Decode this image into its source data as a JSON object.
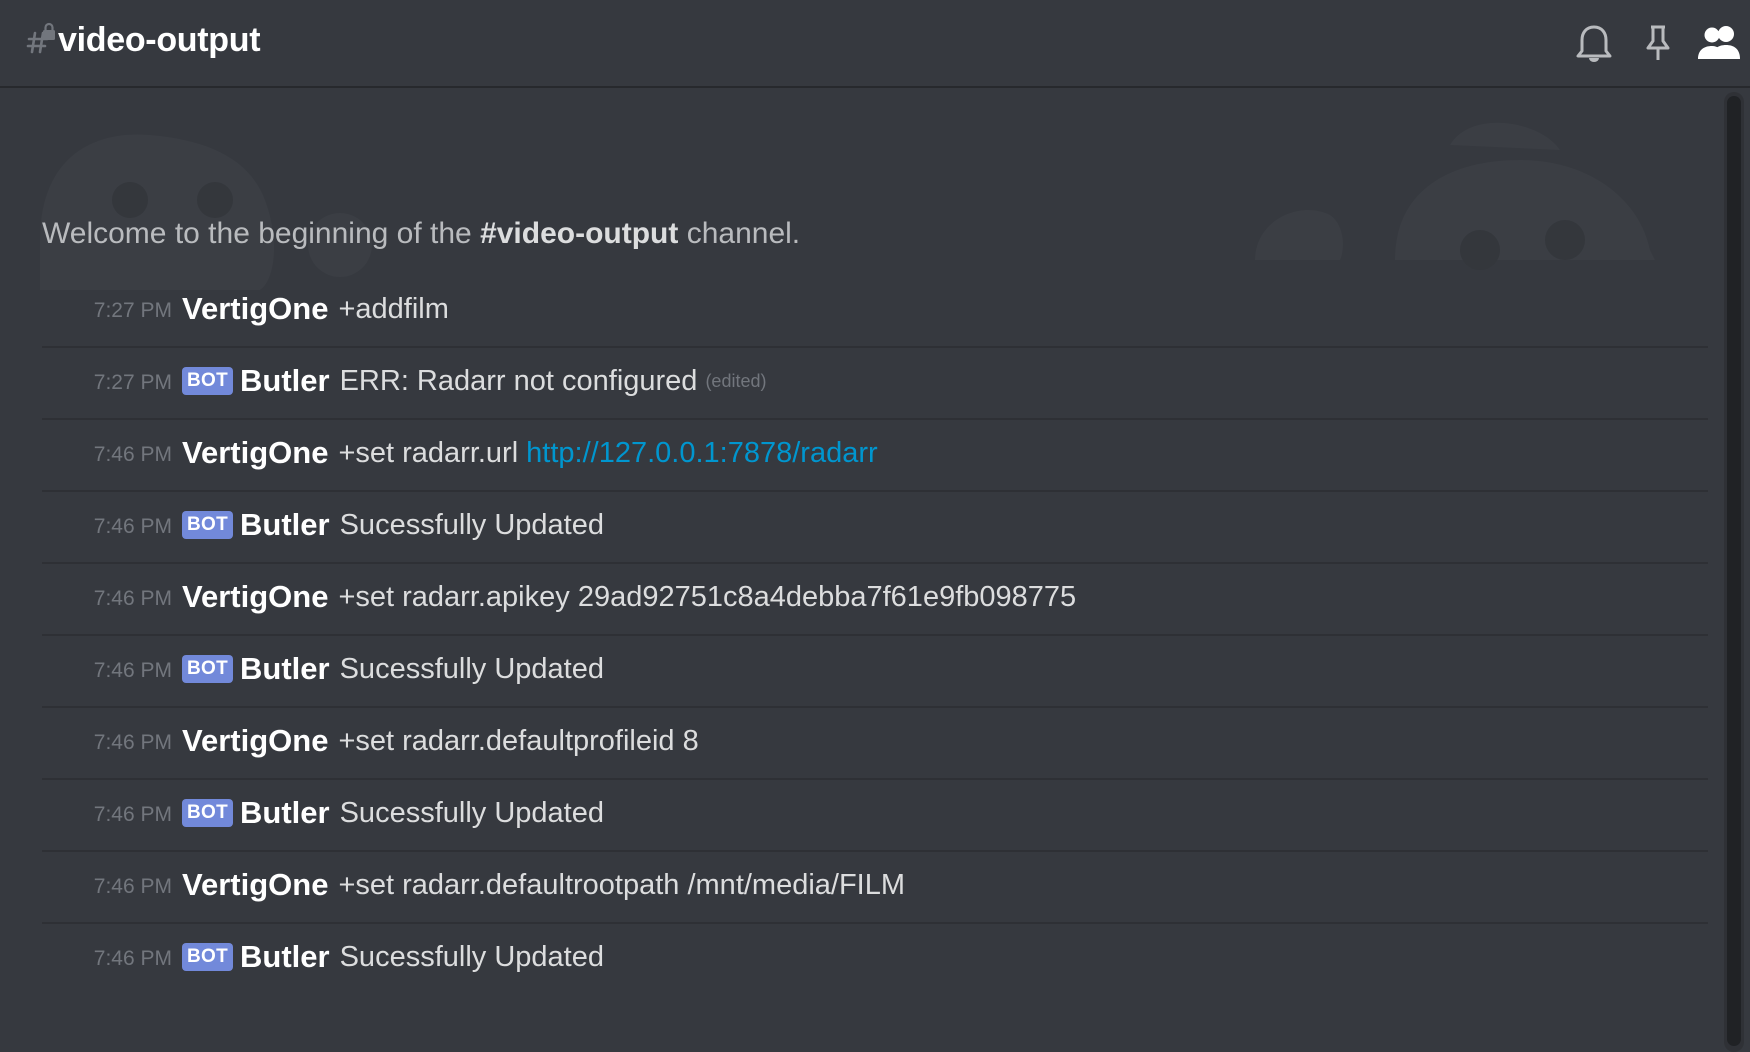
{
  "header": {
    "channel_name": "video-output",
    "icons": [
      "locked-channel-hash-icon",
      "bell-icon",
      "pin-icon",
      "members-icon"
    ]
  },
  "welcome": {
    "prefix": "Welcome to the beginning of the ",
    "channel": "#video-output",
    "suffix": " channel."
  },
  "bot_tag": "BOT",
  "colors": {
    "background": "#36393f",
    "header_border": "#27292d",
    "bot_tag": "#7289da",
    "link": "#0096cf",
    "timestamp": "#72767d",
    "text": "#dcddde"
  },
  "messages": [
    {
      "time": "7:27 PM",
      "author": "VertigOne",
      "bot": false,
      "text": "+addfilm",
      "link": "",
      "edited": ""
    },
    {
      "time": "7:27 PM",
      "author": "Butler",
      "bot": true,
      "text": "ERR: Radarr not configured",
      "link": "",
      "edited": "(edited)"
    },
    {
      "time": "7:46 PM",
      "author": "VertigOne",
      "bot": false,
      "text": "+set radarr.url",
      "link": "http://127.0.0.1:7878/radarr",
      "edited": ""
    },
    {
      "time": "7:46 PM",
      "author": "Butler",
      "bot": true,
      "text": "Sucessfully Updated",
      "link": "",
      "edited": ""
    },
    {
      "time": "7:46 PM",
      "author": "VertigOne",
      "bot": false,
      "text": "+set radarr.apikey 29ad92751c8a4debba7f61e9fb098775",
      "link": "",
      "edited": ""
    },
    {
      "time": "7:46 PM",
      "author": "Butler",
      "bot": true,
      "text": "Sucessfully Updated",
      "link": "",
      "edited": ""
    },
    {
      "time": "7:46 PM",
      "author": "VertigOne",
      "bot": false,
      "text": "+set radarr.defaultprofileid 8",
      "link": "",
      "edited": ""
    },
    {
      "time": "7:46 PM",
      "author": "Butler",
      "bot": true,
      "text": "Sucessfully Updated",
      "link": "",
      "edited": ""
    },
    {
      "time": "7:46 PM",
      "author": "VertigOne",
      "bot": false,
      "text": "+set radarr.defaultrootpath /mnt/media/FILM",
      "link": "",
      "edited": ""
    },
    {
      "time": "7:46 PM",
      "author": "Butler",
      "bot": true,
      "text": "Sucessfully Updated",
      "link": "",
      "edited": ""
    }
  ]
}
